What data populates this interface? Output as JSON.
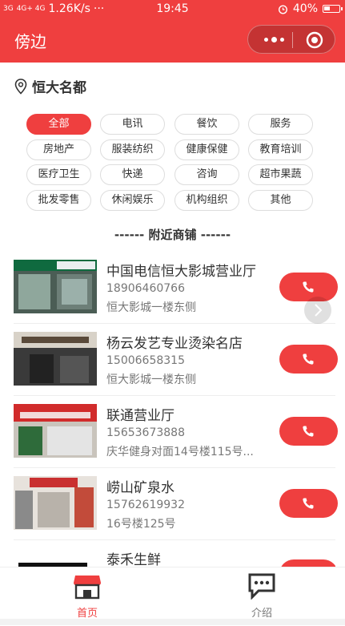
{
  "status_bar": {
    "signal_left": "3G",
    "signal_right": "4G+ 4G",
    "speed": "1.26K/s",
    "more": "···",
    "time": "19:45",
    "battery": "40%"
  },
  "nav": {
    "title": "傍边"
  },
  "location": {
    "name": "恒大名都"
  },
  "categories": [
    {
      "label": "全部",
      "active": true
    },
    {
      "label": "电讯"
    },
    {
      "label": "餐饮"
    },
    {
      "label": "服务"
    },
    {
      "label": "房地产"
    },
    {
      "label": "服装纺织"
    },
    {
      "label": "健康保健"
    },
    {
      "label": "教育培训"
    },
    {
      "label": "医疗卫生"
    },
    {
      "label": "快递"
    },
    {
      "label": "咨询"
    },
    {
      "label": "超市果蔬"
    },
    {
      "label": "批发零售"
    },
    {
      "label": "休闲娱乐"
    },
    {
      "label": "机构组织"
    },
    {
      "label": "其他"
    }
  ],
  "section_title": "------ 附近商铺 ------",
  "shops": [
    {
      "name": "中国电信恒大影城营业厅",
      "phone": "18906460766",
      "address": "恒大影城一楼东侧",
      "sign": "中国电信"
    },
    {
      "name": "杨云发艺专业烫染名店",
      "phone": "15006658315",
      "address": "恒大影城一楼东侧",
      "sign": "杨云发艺"
    },
    {
      "name": "联通营业厅",
      "phone": "15653673888",
      "address": "庆华健身对面14号楼115号...",
      "sign": "联通营业厅"
    },
    {
      "name": "崂山矿泉水",
      "phone": "15762619932",
      "address": "16号楼125号",
      "sign": ""
    },
    {
      "name": "泰禾生鲜",
      "phone": "",
      "address": "",
      "sign": ""
    }
  ],
  "tabs": [
    {
      "label": "首页",
      "active": true
    },
    {
      "label": "介绍"
    }
  ],
  "colors": {
    "brand": "#ef3f3f",
    "text": "#333333",
    "muted": "#777777"
  }
}
